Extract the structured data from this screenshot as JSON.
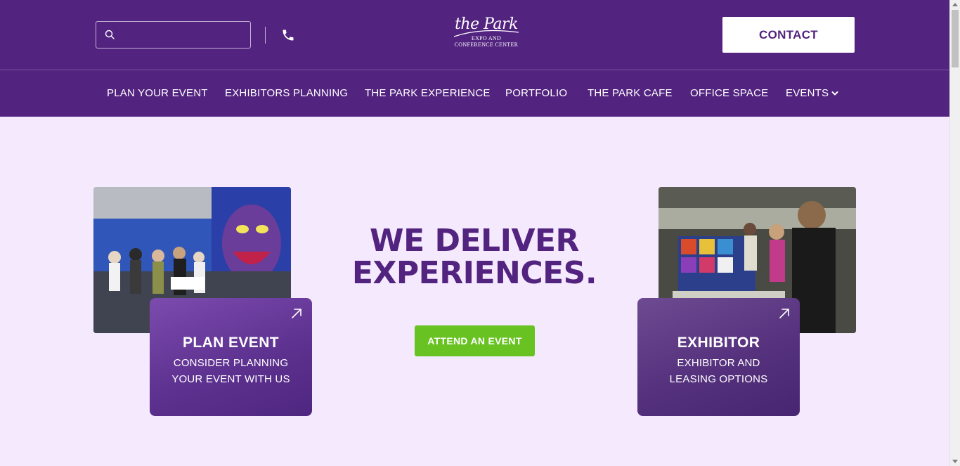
{
  "header": {
    "search": {
      "placeholder": "",
      "value": ""
    },
    "logo": {
      "script": "the Park",
      "line1": "EXPO AND",
      "line2": "CONFERENCE CENTER"
    },
    "contact_label": "CONTACT"
  },
  "nav": {
    "items": [
      {
        "label": "PLAN YOUR EVENT"
      },
      {
        "label": "EXHIBITORS PLANNING"
      },
      {
        "label": "THE PARK EXPERIENCE"
      },
      {
        "label": "PORTFOLIO"
      },
      {
        "label": "THE PARK CAFE"
      },
      {
        "label": "OFFICE SPACE"
      },
      {
        "label": "EVENTS"
      }
    ]
  },
  "hero": {
    "headline_line1": "WE DELIVER",
    "headline_line2": "EXPERIENCES.",
    "cta_label": "ATTEND AN EVENT",
    "cards": [
      {
        "title": "PLAN EVENT",
        "subtitle_line1": "CONSIDER PLANNING",
        "subtitle_line2": "YOUR EVENT WITH US"
      },
      {
        "title": "EXHIBITOR",
        "subtitle_line1": "EXHIBITOR AND",
        "subtitle_line2": "LEASING OPTIONS"
      }
    ]
  },
  "colors": {
    "brand_purple": "#52237f",
    "page_background": "#f4e9fd",
    "cta_green": "#68c221",
    "white": "#ffffff"
  },
  "icons": [
    "search-icon",
    "phone-icon",
    "chevron-down-icon",
    "arrow-up-right-icon"
  ]
}
